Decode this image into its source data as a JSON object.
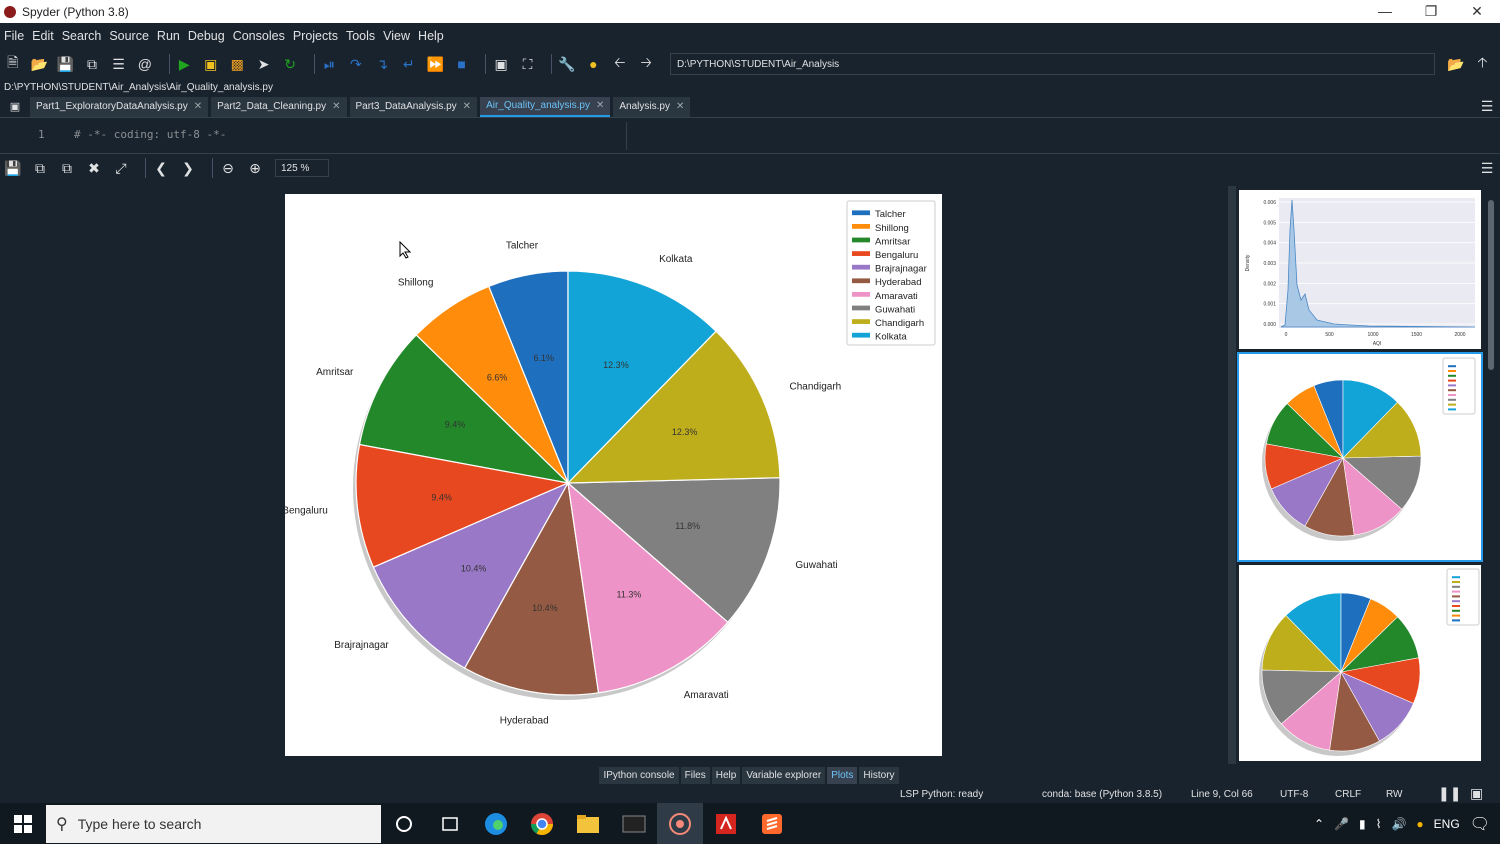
{
  "window": {
    "title": "Spyder (Python 3.8)"
  },
  "menu": [
    "File",
    "Edit",
    "Search",
    "Source",
    "Run",
    "Debug",
    "Consoles",
    "Projects",
    "Tools",
    "View",
    "Help"
  ],
  "toolbar": {
    "path": "D:\\PYTHON\\STUDENT\\Air_Analysis"
  },
  "editor": {
    "filepath": "D:\\PYTHON\\STUDENT\\Air_Analysis\\Air_Quality_analysis.py",
    "tabs": [
      {
        "label": "Part1_ExploratoryDataAnalysis.py",
        "active": false
      },
      {
        "label": "Part2_Data_Cleaning.py",
        "active": false
      },
      {
        "label": "Part3_DataAnalysis.py",
        "active": false
      },
      {
        "label": "Air_Quality_analysis.py",
        "active": true
      },
      {
        "label": "Analysis.py",
        "active": false
      }
    ],
    "line_number": "1",
    "code_line": "# -*- coding: utf-8 -*-"
  },
  "plots_toolbar": {
    "zoom": "125 %"
  },
  "chart_data": {
    "type": "pie",
    "slices": [
      {
        "label": "Talcher",
        "pct_label": "6.1%",
        "value": 6.1,
        "color": "#1f6fbf"
      },
      {
        "label": "Shillong",
        "pct_label": "6.6%",
        "value": 6.6,
        "color": "#ff8c0a"
      },
      {
        "label": "Amritsar",
        "pct_label": "9.4%",
        "value": 9.4,
        "color": "#23882a"
      },
      {
        "label": "Bengaluru",
        "pct_label": "9.4%",
        "value": 9.4,
        "color": "#e8481f"
      },
      {
        "label": "Brajrajnagar",
        "pct_label": "10.4%",
        "value": 10.4,
        "color": "#9a78c8"
      },
      {
        "label": "Hyderabad",
        "pct_label": "10.4%",
        "value": 10.4,
        "color": "#955a43"
      },
      {
        "label": "Amaravati",
        "pct_label": "11.3%",
        "value": 11.3,
        "color": "#ee93c7"
      },
      {
        "label": "Guwahati",
        "pct_label": "11.8%",
        "value": 11.8,
        "color": "#808080"
      },
      {
        "label": "Chandigarh",
        "pct_label": "12.3%",
        "value": 12.3,
        "color": "#bfae1c"
      },
      {
        "label": "Kolkata",
        "pct_label": "12.3%",
        "value": 12.3,
        "color": "#12a4d6"
      }
    ],
    "legend_position": "top-right",
    "start": "top",
    "direction": "clockwise"
  },
  "thumbnails": {
    "kde": {
      "xlabel": "AQI",
      "ylabel": "Density",
      "yticks": [
        "0.006",
        "0.005",
        "0.004",
        "0.003",
        "0.002",
        "0.001",
        "0.000"
      ],
      "xticks": [
        "0",
        "500",
        "1000",
        "1500",
        "2000"
      ]
    }
  },
  "pane_tabs": [
    {
      "label": "IPython console",
      "active": false
    },
    {
      "label": "Files",
      "active": false
    },
    {
      "label": "Help",
      "active": false
    },
    {
      "label": "Variable explorer",
      "active": false
    },
    {
      "label": "Plots",
      "active": true
    },
    {
      "label": "History",
      "active": false
    }
  ],
  "statusbar": {
    "lsp": "LSP Python: ready",
    "conda": "conda: base (Python 3.8.5)",
    "position": "Line 9, Col 66",
    "encoding": "UTF-8",
    "eol": "CRLF",
    "perm": "RW"
  },
  "taskbar": {
    "search_placeholder": "Type here to search",
    "lang": "ENG"
  }
}
